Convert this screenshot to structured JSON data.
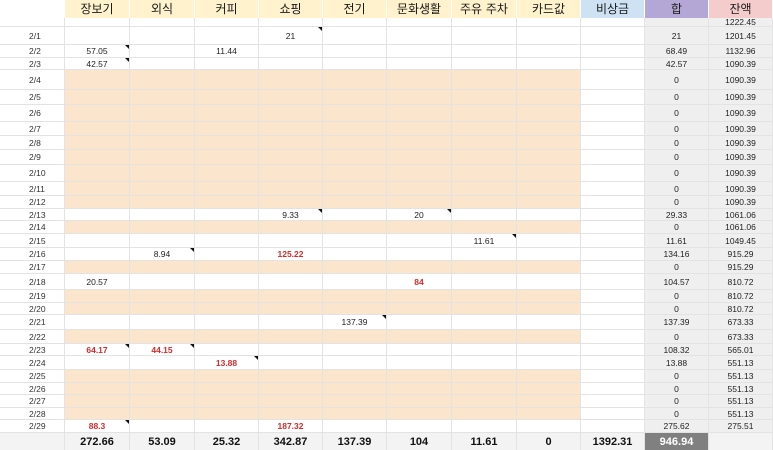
{
  "colors": {
    "header_yellow": "#fff2cc",
    "header_blue": "#cfe2f3",
    "header_purple": "#b4a7d6",
    "header_pink": "#f4cccc",
    "shaded_row": "#fce5cd",
    "gray_column": "#efefef",
    "total_row": "#f3f3f3",
    "sum_total": "#808080",
    "red_value": "#d42b2b"
  },
  "headers": [
    "장보기",
    "외식",
    "커피",
    "쇼핑",
    "전기",
    "문화생활",
    "주유 주차",
    "카드값",
    "비상금",
    "합",
    "잔액"
  ],
  "rows": [
    {
      "date": "",
      "cells": [
        "",
        "",
        "",
        "",
        "",
        "",
        "",
        "",
        "",
        "",
        "1222.45"
      ],
      "shaded": false
    },
    {
      "date": "2/1",
      "cells": [
        "",
        "",
        "",
        "21",
        "",
        "",
        "",
        "",
        "",
        "21",
        "1201.45"
      ],
      "shaded": false
    },
    {
      "date": "2/2",
      "cells": [
        "57.05",
        "",
        "11.44",
        "",
        "",
        "",
        "",
        "",
        "",
        "68.49",
        "1132.96"
      ],
      "shaded": false
    },
    {
      "date": "2/3",
      "cells": [
        "42.57",
        "",
        "",
        "",
        "",
        "",
        "",
        "",
        "",
        "42.57",
        "1090.39"
      ],
      "shaded": false
    },
    {
      "date": "2/4",
      "cells": [
        "",
        "",
        "",
        "",
        "",
        "",
        "",
        "",
        "",
        "0",
        "1090.39"
      ],
      "shaded": true
    },
    {
      "date": "2/5",
      "cells": [
        "",
        "",
        "",
        "",
        "",
        "",
        "",
        "",
        "",
        "0",
        "1090.39"
      ],
      "shaded": true
    },
    {
      "date": "2/6",
      "cells": [
        "",
        "",
        "",
        "",
        "",
        "",
        "",
        "",
        "",
        "0",
        "1090.39"
      ],
      "shaded": true
    },
    {
      "date": "2/7",
      "cells": [
        "",
        "",
        "",
        "",
        "",
        "",
        "",
        "",
        "",
        "0",
        "1090.39"
      ],
      "shaded": true
    },
    {
      "date": "2/8",
      "cells": [
        "",
        "",
        "",
        "",
        "",
        "",
        "",
        "",
        "",
        "0",
        "1090.39"
      ],
      "shaded": true
    },
    {
      "date": "2/9",
      "cells": [
        "",
        "",
        "",
        "",
        "",
        "",
        "",
        "",
        "",
        "0",
        "1090.39"
      ],
      "shaded": true
    },
    {
      "date": "2/10",
      "cells": [
        "",
        "",
        "",
        "",
        "",
        "",
        "",
        "",
        "",
        "0",
        "1090.39"
      ],
      "shaded": true
    },
    {
      "date": "2/11",
      "cells": [
        "",
        "",
        "",
        "",
        "",
        "",
        "",
        "",
        "",
        "0",
        "1090.39"
      ],
      "shaded": true
    },
    {
      "date": "2/12",
      "cells": [
        "",
        "",
        "",
        "",
        "",
        "",
        "",
        "",
        "",
        "0",
        "1090.39"
      ],
      "shaded": true
    },
    {
      "date": "2/13",
      "cells": [
        "",
        "",
        "",
        "9.33",
        "",
        "20",
        "",
        "",
        "",
        "29.33",
        "1061.06"
      ],
      "shaded": false
    },
    {
      "date": "2/14",
      "cells": [
        "",
        "",
        "",
        "",
        "",
        "",
        "",
        "",
        "",
        "0",
        "1061.06"
      ],
      "shaded": true
    },
    {
      "date": "2/15",
      "cells": [
        "",
        "",
        "",
        "",
        "",
        "",
        "11.61",
        "",
        "",
        "11.61",
        "1049.45"
      ],
      "shaded": false
    },
    {
      "date": "2/16",
      "cells": [
        "",
        "8.94",
        "",
        "125.22",
        "",
        "",
        "",
        "",
        "",
        "134.16",
        "915.29"
      ],
      "shaded": false
    },
    {
      "date": "2/17",
      "cells": [
        "",
        "",
        "",
        "",
        "",
        "",
        "",
        "",
        "",
        "0",
        "915.29"
      ],
      "shaded": true
    },
    {
      "date": "2/18",
      "cells": [
        "20.57",
        "",
        "",
        "",
        "",
        "84",
        "",
        "",
        "",
        "104.57",
        "810.72"
      ],
      "shaded": false
    },
    {
      "date": "2/19",
      "cells": [
        "",
        "",
        "",
        "",
        "",
        "",
        "",
        "",
        "",
        "0",
        "810.72"
      ],
      "shaded": true
    },
    {
      "date": "2/20",
      "cells": [
        "",
        "",
        "",
        "",
        "",
        "",
        "",
        "",
        "",
        "0",
        "810.72"
      ],
      "shaded": true
    },
    {
      "date": "2/21",
      "cells": [
        "",
        "",
        "",
        "",
        "137.39",
        "",
        "",
        "",
        "",
        "137.39",
        "673.33"
      ],
      "shaded": false
    },
    {
      "date": "2/22",
      "cells": [
        "",
        "",
        "",
        "",
        "",
        "",
        "",
        "",
        "",
        "0",
        "673.33"
      ],
      "shaded": true
    },
    {
      "date": "2/23",
      "cells": [
        "64.17",
        "44.15",
        "",
        "",
        "",
        "",
        "",
        "",
        "",
        "108.32",
        "565.01"
      ],
      "shaded": false
    },
    {
      "date": "2/24",
      "cells": [
        "",
        "",
        "13.88",
        "",
        "",
        "",
        "",
        "",
        "",
        "13.88",
        "551.13"
      ],
      "shaded": false
    },
    {
      "date": "2/25",
      "cells": [
        "",
        "",
        "",
        "",
        "",
        "",
        "",
        "",
        "",
        "0",
        "551.13"
      ],
      "shaded": true
    },
    {
      "date": "2/26",
      "cells": [
        "",
        "",
        "",
        "",
        "",
        "",
        "",
        "",
        "",
        "0",
        "551.13"
      ],
      "shaded": true
    },
    {
      "date": "2/27",
      "cells": [
        "",
        "",
        "",
        "",
        "",
        "",
        "",
        "",
        "",
        "0",
        "551.13"
      ],
      "shaded": true
    },
    {
      "date": "2/28",
      "cells": [
        "",
        "",
        "",
        "",
        "",
        "",
        "",
        "",
        "",
        "0",
        "551.13"
      ],
      "shaded": true
    },
    {
      "date": "2/29",
      "cells": [
        "88.3",
        "",
        "",
        "187.32",
        "",
        "",
        "",
        "",
        "",
        "275.62",
        "275.51"
      ],
      "shaded": false
    }
  ],
  "red_cells": [
    "16-3",
    "18-5",
    "23-0",
    "23-1",
    "24-2",
    "29-0",
    "29-3"
  ],
  "note_cells": [
    "1-3",
    "2-0",
    "3-0",
    "13-3",
    "13-5",
    "15-6",
    "16-1",
    "21-4",
    "23-0",
    "23-1",
    "24-2",
    "29-0"
  ],
  "totals": [
    "272.66",
    "53.09",
    "25.32",
    "342.87",
    "137.39",
    "104",
    "11.61",
    "0",
    "1392.31",
    "946.94",
    ""
  ]
}
